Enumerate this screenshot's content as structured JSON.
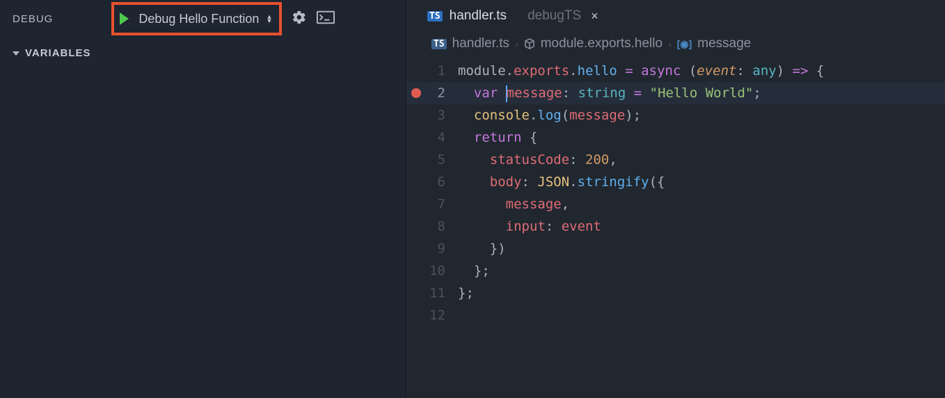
{
  "sidebar": {
    "title": "DEBUG",
    "config_name": "Debug Hello Function",
    "variables_label": "VARIABLES"
  },
  "tabs": [
    {
      "lang": "TS",
      "name": "handler.ts",
      "active": true,
      "closable": false
    },
    {
      "lang": "",
      "name": "debugTS",
      "active": false,
      "closable": true
    }
  ],
  "breadcrumbs": [
    {
      "icon": "ts",
      "label": "handler.ts"
    },
    {
      "icon": "module",
      "label": "module.exports.hello"
    },
    {
      "icon": "var",
      "label": "message"
    }
  ],
  "code": {
    "lines": [
      {
        "num": 1,
        "bp": false,
        "hl": false,
        "tokens": [
          [
            "",
            "module"
          ],
          [
            "punc",
            "."
          ],
          [
            "prop",
            "exports"
          ],
          [
            "punc",
            "."
          ],
          [
            "func",
            "hello"
          ],
          [
            "punc",
            " "
          ],
          [
            "kw",
            "="
          ],
          [
            "punc",
            " "
          ],
          [
            "kw",
            "async"
          ],
          [
            "punc",
            " ("
          ],
          [
            "param",
            "event"
          ],
          [
            "punc",
            ": "
          ],
          [
            "type",
            "any"
          ],
          [
            "punc",
            ") "
          ],
          [
            "kw",
            "=>"
          ],
          [
            "punc",
            " {"
          ]
        ]
      },
      {
        "num": 2,
        "bp": true,
        "hl": true,
        "cursor_at": 6,
        "tokens": [
          [
            "",
            "  "
          ],
          [
            "kw",
            "var"
          ],
          [
            "punc",
            " "
          ],
          [
            "var",
            "message"
          ],
          [
            "punc",
            ": "
          ],
          [
            "type",
            "string"
          ],
          [
            "punc",
            " "
          ],
          [
            "kw",
            "="
          ],
          [
            "punc",
            " "
          ],
          [
            "str",
            "\"Hello World\""
          ],
          [
            "punc",
            ";"
          ]
        ]
      },
      {
        "num": 3,
        "bp": false,
        "hl": false,
        "tokens": [
          [
            "",
            "  "
          ],
          [
            "const",
            "console"
          ],
          [
            "punc",
            "."
          ],
          [
            "func",
            "log"
          ],
          [
            "punc",
            "("
          ],
          [
            "var",
            "message"
          ],
          [
            "punc",
            ");"
          ]
        ]
      },
      {
        "num": 4,
        "bp": false,
        "hl": false,
        "tokens": [
          [
            "",
            "  "
          ],
          [
            "kw",
            "return"
          ],
          [
            "punc",
            " {"
          ]
        ]
      },
      {
        "num": 5,
        "bp": false,
        "hl": false,
        "tokens": [
          [
            "",
            "    "
          ],
          [
            "prop",
            "statusCode"
          ],
          [
            "punc",
            ": "
          ],
          [
            "num",
            "200"
          ],
          [
            "punc",
            ","
          ]
        ]
      },
      {
        "num": 6,
        "bp": false,
        "hl": false,
        "tokens": [
          [
            "",
            "    "
          ],
          [
            "prop",
            "body"
          ],
          [
            "punc",
            ": "
          ],
          [
            "const",
            "JSON"
          ],
          [
            "punc",
            "."
          ],
          [
            "func",
            "stringify"
          ],
          [
            "punc",
            "({"
          ]
        ]
      },
      {
        "num": 7,
        "bp": false,
        "hl": false,
        "tokens": [
          [
            "",
            "      "
          ],
          [
            "var",
            "message"
          ],
          [
            "punc",
            ","
          ]
        ]
      },
      {
        "num": 8,
        "bp": false,
        "hl": false,
        "tokens": [
          [
            "",
            "      "
          ],
          [
            "prop",
            "input"
          ],
          [
            "punc",
            ": "
          ],
          [
            "var",
            "event"
          ]
        ]
      },
      {
        "num": 9,
        "bp": false,
        "hl": false,
        "tokens": [
          [
            "",
            "    })"
          ]
        ]
      },
      {
        "num": 10,
        "bp": false,
        "hl": false,
        "tokens": [
          [
            "",
            "  };"
          ]
        ]
      },
      {
        "num": 11,
        "bp": false,
        "hl": false,
        "tokens": [
          [
            "punc",
            "};"
          ]
        ]
      },
      {
        "num": 12,
        "bp": false,
        "hl": false,
        "tokens": [
          [
            "",
            ""
          ]
        ]
      }
    ]
  }
}
